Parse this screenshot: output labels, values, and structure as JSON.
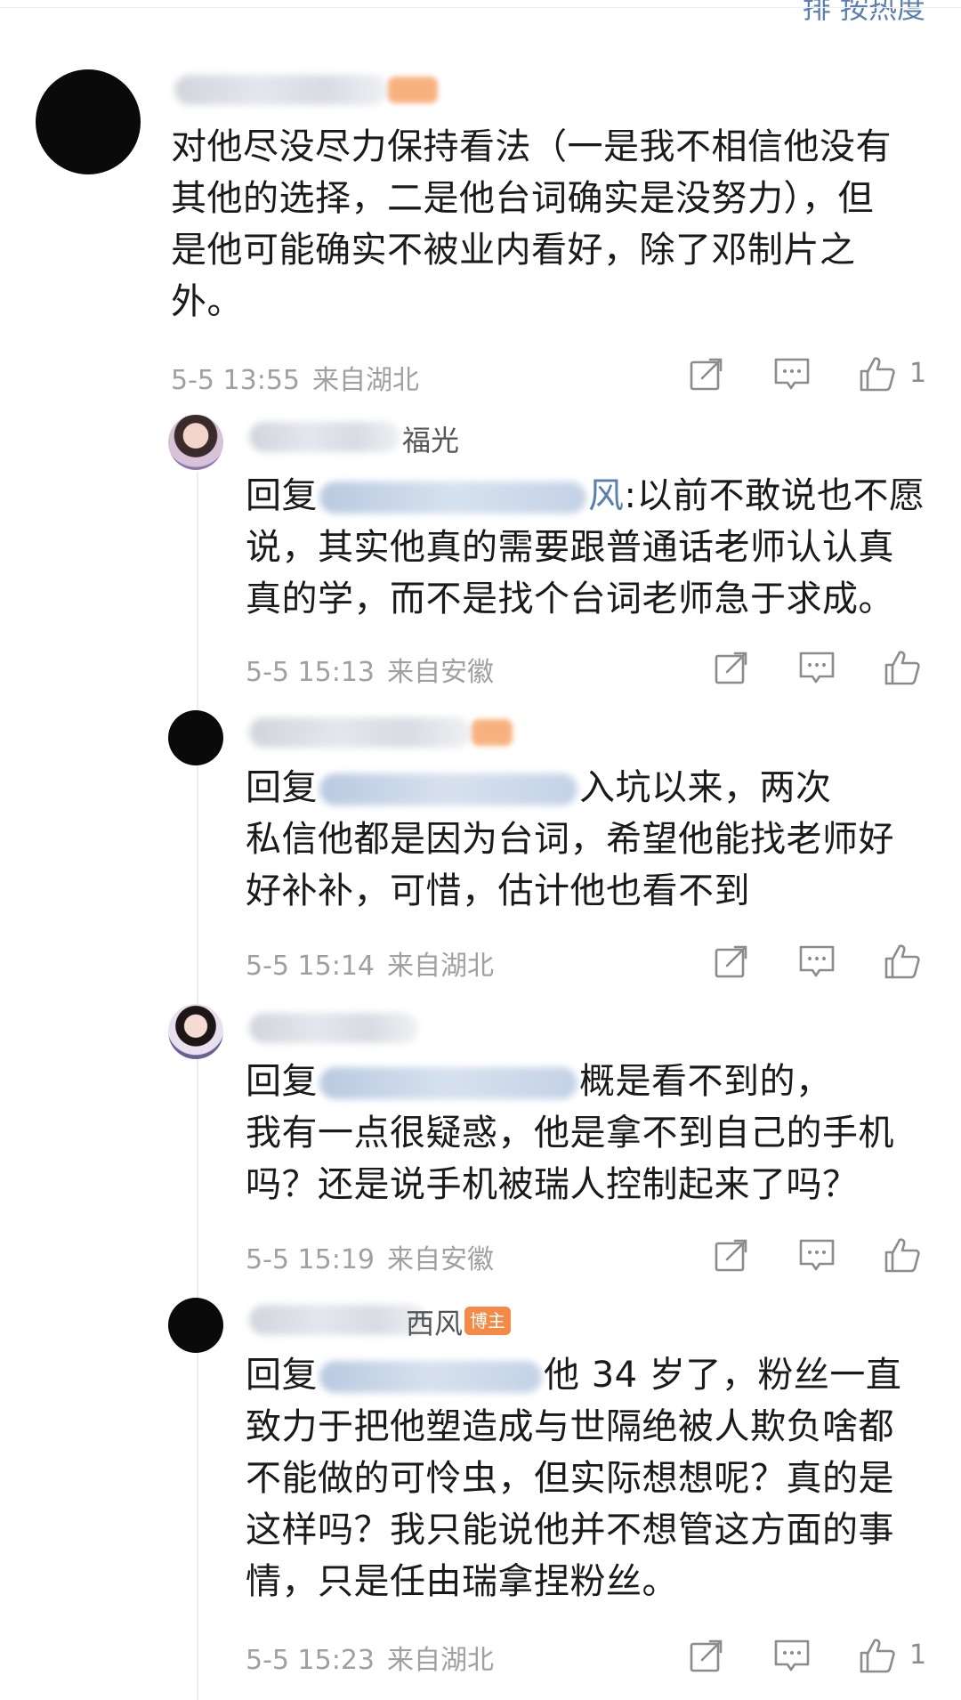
{
  "header": {
    "sort_label": "排 按热度"
  },
  "comment": {
    "text": "对他尽没尽力保持看法（一是我不相信他没有其他的选择，二是他台词确实是没努力），但是他可能确实不被业内看好，除了邓制片之外。",
    "lines": [
      "对他尽没尽力保持看法（一是我不相信他没有",
      "其他的选择，二是他台词确实是没努力），但",
      "是他可能确实不被业内看好，除了邓制片之",
      "外。"
    ],
    "time": "5-5 13:55",
    "location": "来自湖北",
    "likes": "1"
  },
  "replies": [
    {
      "name_tail": "福光",
      "prefix": "回复",
      "mention_tail": "风",
      "lines": [
        ":以前不敢说也不愿",
        "说，其实他真的需要跟普通话老师认认真",
        "真的学，而不是找个台词老师急于求成。"
      ],
      "time": "5-5 15:13",
      "location": "来自安徽",
      "likes": ""
    },
    {
      "name_tail": "",
      "prefix": "回复",
      "mention_tail": "",
      "lines": [
        "入坑以来，两次",
        "私信他都是因为台词，希望他能找老师好",
        "好补补，可惜，估计他也看不到"
      ],
      "time": "5-5 15:14",
      "location": "来自湖北",
      "likes": ""
    },
    {
      "name_tail": "",
      "prefix": "回复",
      "mention_tail": "",
      "lines": [
        "概是看不到的，",
        "我有一点很疑惑，他是拿不到自己的手机",
        "吗？还是说手机被瑞人控制起来了吗？"
      ],
      "time": "5-5 15:19",
      "location": "来自安徽",
      "likes": ""
    },
    {
      "name_tail": "西风",
      "badge": "博主",
      "prefix": "回复",
      "mention_tail": "",
      "lines": [
        "他 34 岁了，粉丝一直",
        "致力于把他塑造成与世隔绝被人欺负啥都",
        "不能做的可怜虫，但实际想想呢？真的是",
        "这样吗？我只能说他并不想管这方面的事",
        "情，只是任由瑞拿捏粉丝。"
      ],
      "time": "5-5 15:23",
      "location": "来自湖北",
      "likes": "1"
    }
  ],
  "icons": {
    "share": "share-icon",
    "comment": "comment-icon",
    "like": "like-icon"
  }
}
